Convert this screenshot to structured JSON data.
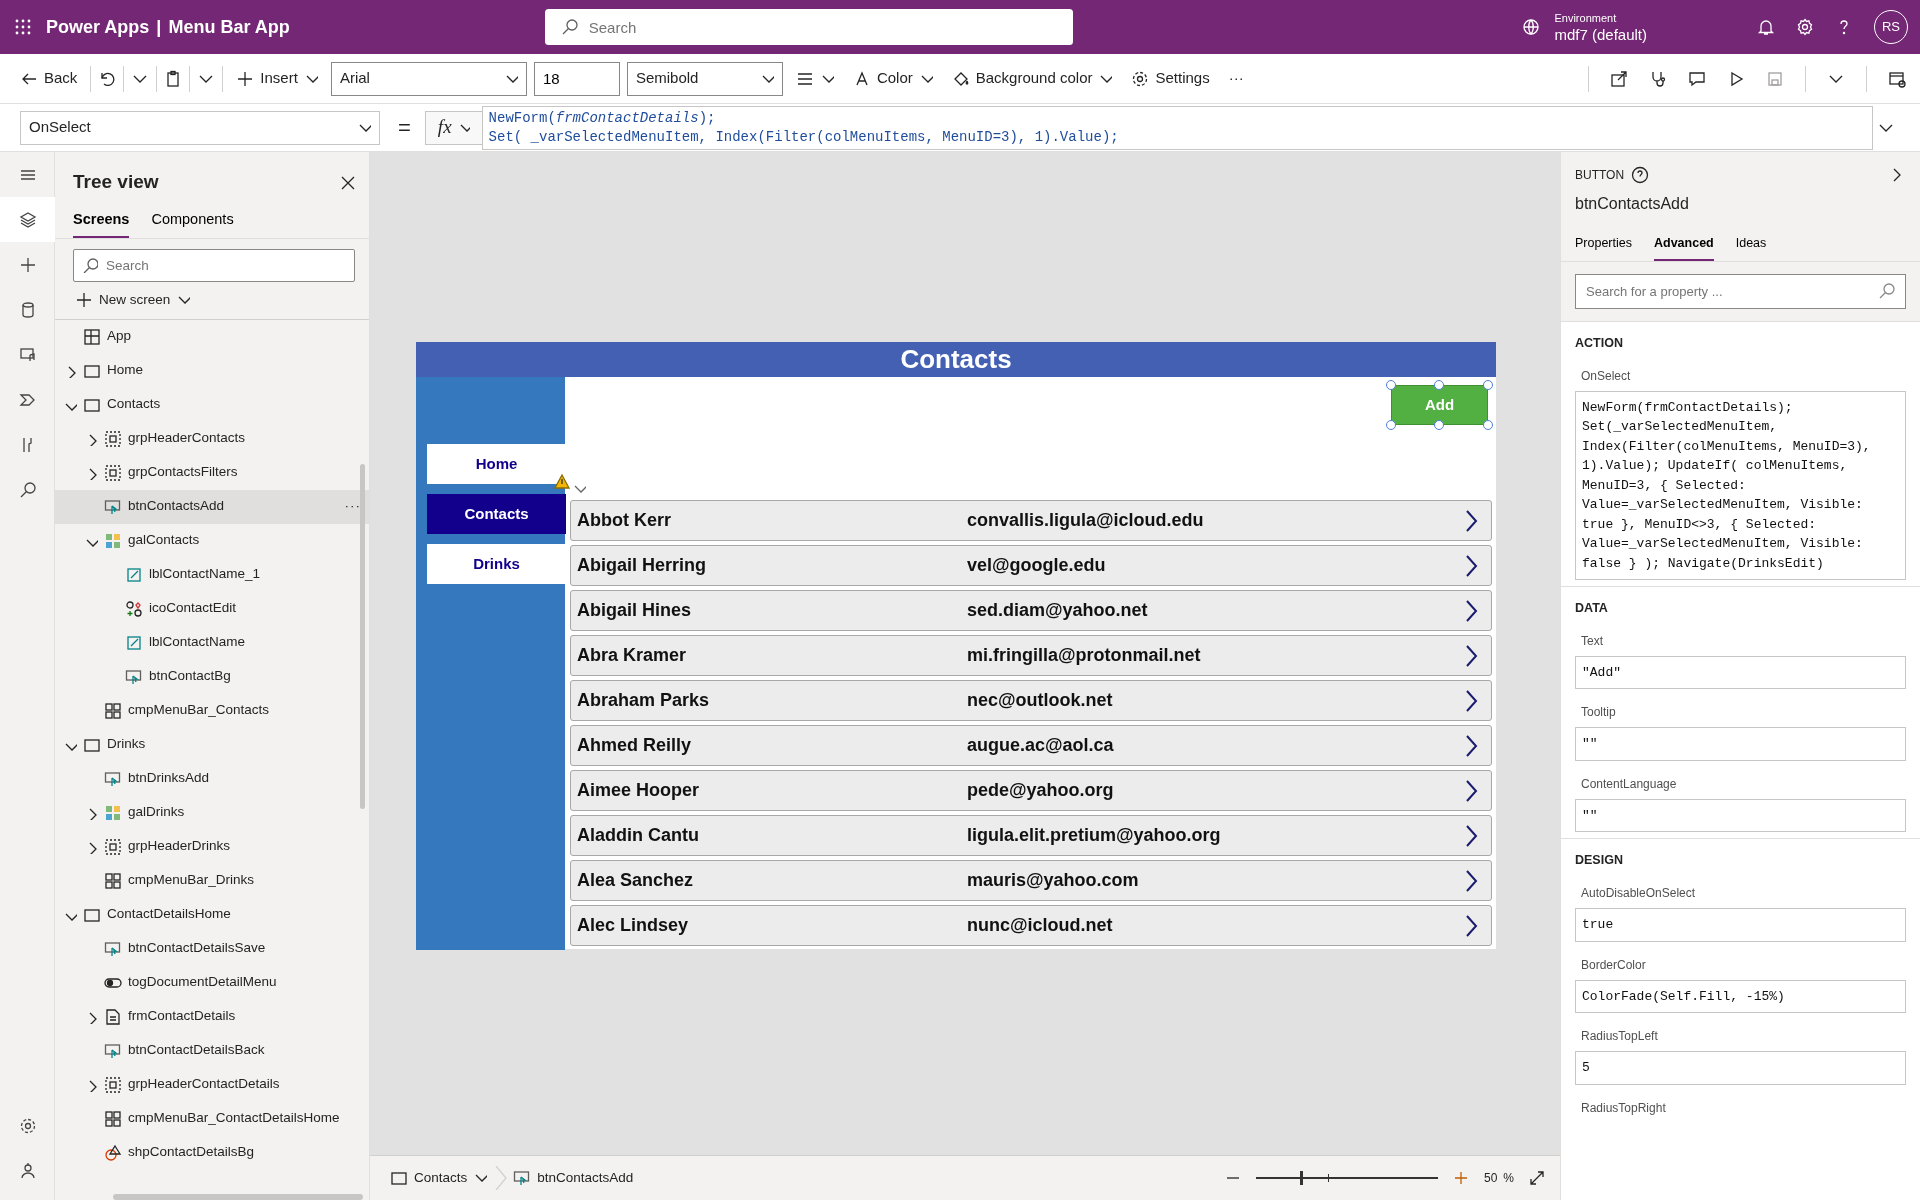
{
  "app_bar": {
    "title": "Power Apps",
    "separator": "|",
    "app_name": "Menu Bar App",
    "search": {
      "placeholder": "Search"
    },
    "environment_label": "Environment",
    "environment": "mdf7 (default)",
    "avatar": "RS"
  },
  "toolbar": {
    "back": "Back",
    "insert": "Insert",
    "font": "Arial",
    "font_size": "18",
    "font_weight": "Semibold",
    "color_label": "Color",
    "fill_label": "Background color",
    "settings": "Settings",
    "more": "···"
  },
  "formula_bar": {
    "property": "OnSelect",
    "equals": "=",
    "fx": "fx",
    "lines": [
      "NewForm(*frmContactDetails*);",
      "Set( _varSelectedMenuItem, Index(Filter(colMenuItems, MenuID=3), 1).Value);"
    ]
  },
  "tree_view": {
    "title": "Tree view",
    "tabs": [
      {
        "label": "Screens",
        "selected": true
      },
      {
        "label": "Components",
        "selected": false
      }
    ],
    "search": {
      "placeholder": "Search"
    },
    "new_screen": "New screen",
    "item_more": "···",
    "items": [
      {
        "label": "App",
        "kind": "app",
        "selected": false
      },
      {
        "label": "Home",
        "kind": "screen",
        "expanded": false,
        "selected": false
      },
      {
        "label": "Contacts",
        "kind": "screen",
        "expanded": true,
        "selected": false,
        "children": [
          {
            "label": "grpHeaderContacts",
            "kind": "group",
            "expanded": false,
            "selected": false
          },
          {
            "label": "grpContactsFilters",
            "kind": "group",
            "expanded": false,
            "selected": false
          },
          {
            "label": "btnContactsAdd",
            "kind": "button",
            "selected": true
          },
          {
            "label": "galContacts",
            "kind": "gallery",
            "expanded": true,
            "selected": false,
            "children": [
              {
                "label": "lblContactName_1",
                "kind": "label",
                "selected": false
              },
              {
                "label": "icoContactEdit",
                "kind": "icon",
                "selected": false
              },
              {
                "label": "lblContactName",
                "kind": "label",
                "selected": false
              },
              {
                "label": "btnContactBg",
                "kind": "button",
                "selected": false
              }
            ]
          },
          {
            "label": "cmpMenuBar_Contacts",
            "kind": "component",
            "selected": false
          }
        ]
      },
      {
        "label": "Drinks",
        "kind": "screen",
        "expanded": true,
        "selected": false,
        "children": [
          {
            "label": "btnDrinksAdd",
            "kind": "button",
            "selected": false
          },
          {
            "label": "galDrinks",
            "kind": "gallery",
            "expanded": false,
            "selected": false
          },
          {
            "label": "grpHeaderDrinks",
            "kind": "group",
            "expanded": false,
            "selected": false
          },
          {
            "label": "cmpMenuBar_Drinks",
            "kind": "component",
            "selected": false
          }
        ]
      },
      {
        "label": "ContactDetailsHome",
        "kind": "screen",
        "expanded": true,
        "selected": false,
        "children": [
          {
            "label": "btnContactDetailsSave",
            "kind": "button",
            "selected": false
          },
          {
            "label": "togDocumentDetailMenu",
            "kind": "toggle",
            "selected": false
          },
          {
            "label": "frmContactDetails",
            "kind": "form",
            "expanded": false,
            "selected": false
          },
          {
            "label": "btnContactDetailsBack",
            "kind": "button",
            "selected": false
          },
          {
            "label": "grpHeaderContactDetails",
            "kind": "group",
            "expanded": false,
            "selected": false
          },
          {
            "label": "cmpMenuBar_ContactDetailsHome",
            "kind": "component",
            "selected": false
          },
          {
            "label": "shpContactDetailsBg",
            "kind": "shape",
            "selected": false
          }
        ]
      }
    ]
  },
  "app_screen": {
    "title": "Contacts",
    "add_button": "Add",
    "menu": [
      {
        "label": "Home",
        "selected": false
      },
      {
        "label": "Contacts",
        "selected": true
      },
      {
        "label": "Drinks",
        "selected": false
      }
    ],
    "contacts": [
      {
        "name": "Abbot Kerr",
        "email": "convallis.ligula@icloud.edu"
      },
      {
        "name": "Abigail Herring",
        "email": "vel@google.edu"
      },
      {
        "name": "Abigail Hines",
        "email": "sed.diam@yahoo.net"
      },
      {
        "name": "Abra Kramer",
        "email": "mi.fringilla@protonmail.net"
      },
      {
        "name": "Abraham Parks",
        "email": "nec@outlook.net"
      },
      {
        "name": "Ahmed Reilly",
        "email": "augue.ac@aol.ca"
      },
      {
        "name": "Aimee Hooper",
        "email": "pede@yahoo.org"
      },
      {
        "name": "Aladdin Cantu",
        "email": "ligula.elit.pretium@yahoo.org"
      },
      {
        "name": "Alea Sanchez",
        "email": "mauris@yahoo.com"
      },
      {
        "name": "Alec Lindsey",
        "email": "nunc@icloud.net"
      }
    ]
  },
  "status_bar": {
    "screen": "Contacts",
    "control": "btnContactsAdd",
    "zoom_slider": {
      "level": 0.25
    },
    "zoom": "50",
    "zoom_unit": "%"
  },
  "properties_panel": {
    "type": "BUTTON",
    "control": "btnContactsAdd",
    "tabs": [
      {
        "label": "Properties",
        "selected": false
      },
      {
        "label": "Advanced",
        "selected": true
      },
      {
        "label": "Ideas",
        "selected": false
      }
    ],
    "search": {
      "placeholder": "Search for a property ..."
    },
    "sections": [
      {
        "title": "ACTION",
        "properties": [
          {
            "label": "OnSelect",
            "value": "NewForm(frmContactDetails); Set(_varSelectedMenuItem, Index(Filter(colMenuItems, MenuID=3), 1).Value); UpdateIf( colMenuItems, MenuID=3, { Selected: Value=_varSelectedMenuItem, Visible: true }, MenuID<>3, { Selected: Value=_varSelectedMenuItem, Visible: false } ); Navigate(DrinksEdit)"
          }
        ]
      },
      {
        "title": "DATA",
        "properties": [
          {
            "label": "Text",
            "value": "\"Add\""
          },
          {
            "label": "Tooltip",
            "value": "\"\""
          },
          {
            "label": "ContentLanguage",
            "value": "\"\""
          }
        ]
      },
      {
        "title": "DESIGN",
        "properties": [
          {
            "label": "AutoDisableOnSelect",
            "value": "true"
          },
          {
            "label": "BorderColor",
            "value": "ColorFade(Self.Fill, -15%)"
          },
          {
            "label": "RadiusTopLeft",
            "value": "5"
          },
          {
            "label": "RadiusTopRight"
          }
        ]
      }
    ]
  }
}
